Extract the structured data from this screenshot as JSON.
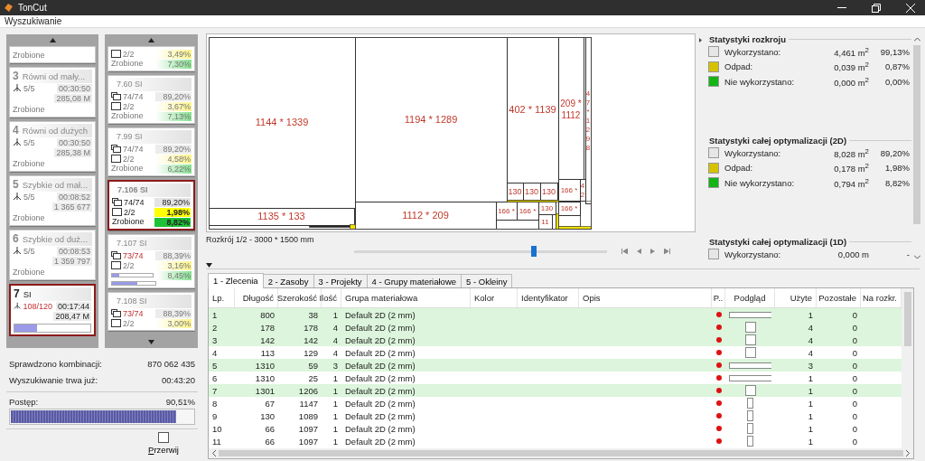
{
  "window": {
    "title": "TonCut"
  },
  "menu": [
    {
      "label": "Wyszukiwanie"
    }
  ],
  "search_groups": [
    {
      "status": "Zrobione",
      "selected": false
    },
    {
      "number": "3",
      "title": "Równi od mały...",
      "count": "5/5",
      "count_complete": true,
      "time": "00:30:50",
      "combinations": "285,08 M",
      "status": "Zrobione",
      "selected": false
    },
    {
      "number": "4",
      "title": "Równi od dużych",
      "count": "5/5",
      "count_complete": true,
      "time": "00:30:50",
      "combinations": "285,38 M",
      "status": "Zrobione",
      "selected": false
    },
    {
      "number": "5",
      "title": "Szybkie od mał...",
      "count": "5/5",
      "count_complete": true,
      "time": "00:08:52",
      "combinations": "1 365 677",
      "status": "Zrobione",
      "selected": false
    },
    {
      "number": "6",
      "title": "Szybkie od duż...",
      "count": "5/5",
      "count_complete": true,
      "time": "00:08:53",
      "combinations": "1 359 797",
      "status": "Zrobione",
      "selected": false
    },
    {
      "number": "7",
      "title": "SI",
      "count": "108/120",
      "count_complete": false,
      "time": "00:17:44",
      "combinations": "208,47 M",
      "level": 0.3,
      "selected": true
    }
  ],
  "search_results": [
    {
      "sheets": "2/2",
      "waste": "3,49%",
      "unused": "7,30%",
      "status": "Zrobione",
      "selected": false
    },
    {
      "title": "7.60  SI",
      "parts": "74/74",
      "parts_complete": true,
      "used": "89,20%",
      "sheets": "2/2",
      "waste": "3,67%",
      "unused": "7,13%",
      "status": "Zrobione",
      "selected": false
    },
    {
      "title": "7.99  SI",
      "parts": "74/74",
      "parts_complete": true,
      "used": "89,20%",
      "sheets": "2/2",
      "waste": "4,58%",
      "unused": "6,22%",
      "status": "Zrobione",
      "selected": false
    },
    {
      "title": "7.106  SI",
      "parts": "74/74",
      "parts_complete": true,
      "used": "89,20%",
      "sheets": "2/2",
      "waste": "1,98%",
      "unused": "8,82%",
      "status": "Zrobione",
      "selected": true
    },
    {
      "title": "7.107  SI",
      "parts": "73/74",
      "parts_complete": false,
      "used": "88,39%",
      "sheets": "2/2",
      "waste": "3,16%",
      "unused": "8,45%",
      "progress": [
        {
          "level": 0.17
        },
        {
          "level": 0.58
        }
      ],
      "selected": false
    },
    {
      "title": "7.108  SI",
      "parts": "73/74",
      "parts_complete": false,
      "used": "88,39%",
      "sheets": "2/2",
      "waste": "3,00%",
      "selected": false
    }
  ],
  "summary": [
    {
      "label": "Sprawdzono kombinacji:",
      "value": "870 062 435"
    },
    {
      "label": "Wyszukiwanie trwa już:",
      "value": "00:43:20"
    }
  ],
  "progress": {
    "label": "Postęp:",
    "value": "90,51%",
    "level": 0.9051
  },
  "stop_button": {
    "label": "Przerwij"
  },
  "cut_plan": {
    "pieces": [
      {
        "label": "1144 * 1339"
      },
      {
        "label": "1135 * 133"
      },
      {
        "label": "1194 * 1289"
      },
      {
        "label": "1112 * 209"
      },
      {
        "label": "402 * 1139"
      },
      {
        "label": "130"
      },
      {
        "label": "130"
      },
      {
        "label": "130"
      },
      {
        "label": "209 * 1112"
      },
      {
        "label": "47*1298"
      },
      {
        "label": "166 *"
      },
      {
        "label": "42"
      },
      {
        "label": "166 *"
      },
      {
        "label": "166 *"
      },
      {
        "label": "130"
      },
      {
        "label": "11"
      },
      {
        "label": "166 *"
      }
    ],
    "caption": "Rozkrój 1/2 - 3000 * 1500 mm",
    "slider": {
      "level": 0.71
    }
  },
  "stats": {
    "sections": [
      {
        "title": "Statystyki rozkroju",
        "rows": [
          {
            "label": "Wykorzystano:",
            "value": "4,461 m$^{2}$",
            "percent": "99,13%",
            "color": "#e6e6e6"
          },
          {
            "label": "Odpad:",
            "value": "0,039 m$^{2}$",
            "percent": "0,87%",
            "color": "#d6c200"
          },
          {
            "label": "Nie wykorzystano:",
            "value": "0,000 m$^{2}$",
            "percent": "0,00%",
            "color": "#14b414"
          }
        ]
      },
      {
        "title": "Statystyki całej optymalizacji (2D)",
        "rows": [
          {
            "label": "Wykorzystano:",
            "value": "8,028 m$^{2}$",
            "percent": "89,20%",
            "color": "#e6e6e6"
          },
          {
            "label": "Odpad:",
            "value": "0,178 m$^{2}$",
            "percent": "1,98%",
            "color": "#d6c200"
          },
          {
            "label": "Nie wykorzystano:",
            "value": "0,794 m$^{2}$",
            "percent": "8,82%",
            "color": "#14b414"
          }
        ]
      },
      {
        "title": "Statystyki całej optymalizacji (1D)",
        "rows": [
          {
            "label": "Wykorzystano:",
            "value": "0,000 m",
            "percent": "-",
            "color": "#e6e6e6"
          }
        ]
      }
    ]
  },
  "orders": {
    "tabs": [
      {
        "label": "1 - Zlecenia",
        "selected": true
      },
      {
        "label": "2 - Zasoby",
        "selected": false
      },
      {
        "label": "3 - Projekty",
        "selected": false
      },
      {
        "label": "4 - Grupy materiałowe",
        "selected": false
      },
      {
        "label": "5 - Okleiny",
        "selected": false
      }
    ],
    "columns": [
      "Lp.",
      "Długość",
      "Szerokość",
      "Ilość",
      "Grupa materiałowa",
      "Kolor",
      "Identyfikator",
      "Opis",
      "P..",
      "Podgląd",
      "Użyte",
      "Pozostałe",
      "Na rozkr."
    ],
    "rows": [
      {
        "cells": [
          "1",
          "800",
          "38",
          "1",
          "Default 2D (2 mm)"
        ],
        "used": "1",
        "remaining": "0",
        "highlighted": true
      },
      {
        "cells": [
          "2",
          "178",
          "178",
          "4",
          "Default 2D (2 mm)"
        ],
        "used": "4",
        "remaining": "0",
        "highlighted": true
      },
      {
        "cells": [
          "3",
          "142",
          "142",
          "4",
          "Default 2D (2 mm)"
        ],
        "used": "4",
        "remaining": "0",
        "highlighted": true
      },
      {
        "cells": [
          "4",
          "113",
          "129",
          "4",
          "Default 2D (2 mm)"
        ],
        "used": "4",
        "remaining": "0",
        "highlighted": false
      },
      {
        "cells": [
          "5",
          "1310",
          "59",
          "3",
          "Default 2D (2 mm)"
        ],
        "used": "3",
        "remaining": "0",
        "highlighted": true
      },
      {
        "cells": [
          "6",
          "1310",
          "25",
          "1",
          "Default 2D (2 mm)"
        ],
        "used": "1",
        "remaining": "0",
        "highlighted": false
      },
      {
        "cells": [
          "7",
          "1301",
          "1206",
          "1",
          "Default 2D (2 mm)"
        ],
        "used": "1",
        "remaining": "0",
        "highlighted": true
      },
      {
        "cells": [
          "8",
          "67",
          "1147",
          "1",
          "Default 2D (2 mm)"
        ],
        "used": "1",
        "remaining": "0",
        "highlighted": false
      },
      {
        "cells": [
          "9",
          "130",
          "1089",
          "1",
          "Default 2D (2 mm)"
        ],
        "used": "1",
        "remaining": "0",
        "highlighted": false
      },
      {
        "cells": [
          "10",
          "66",
          "1097",
          "1",
          "Default 2D (2 mm)"
        ],
        "used": "1",
        "remaining": "0",
        "highlighted": false
      },
      {
        "cells": [
          "11",
          "66",
          "1097",
          "1",
          "Default 2D (2 mm)"
        ],
        "used": "1",
        "remaining": "0",
        "highlighted": false
      }
    ]
  }
}
